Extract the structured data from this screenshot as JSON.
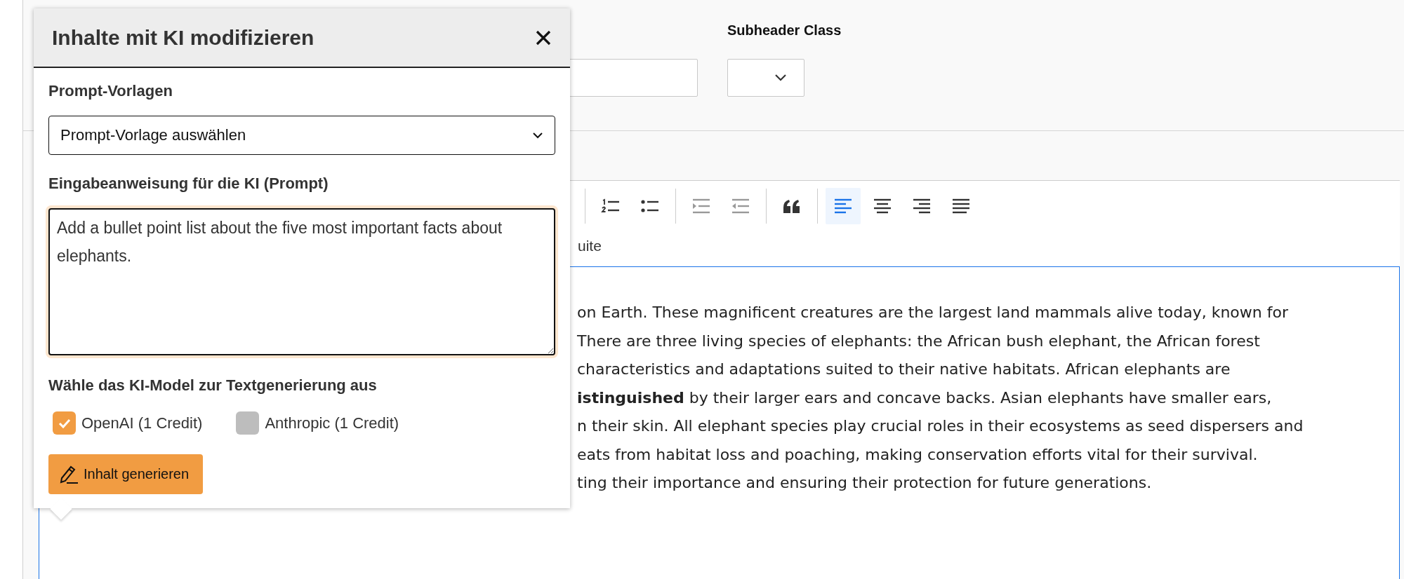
{
  "form": {
    "subheader_label": "Subheader Class"
  },
  "editor": {
    "toolbar_groups": [
      [
        {
          "kind": "ordered-list",
          "selected": false,
          "disabled": false
        },
        {
          "kind": "bullet-list",
          "selected": false,
          "disabled": false
        }
      ],
      [
        {
          "kind": "indent",
          "selected": false,
          "disabled": true
        },
        {
          "kind": "outdent",
          "selected": false,
          "disabled": true
        }
      ],
      [
        {
          "kind": "quote",
          "selected": false,
          "disabled": false
        }
      ],
      [
        {
          "kind": "align-left",
          "selected": true,
          "disabled": false
        },
        {
          "kind": "align-center",
          "selected": false,
          "disabled": false
        },
        {
          "kind": "align-right",
          "selected": false,
          "disabled": false
        },
        {
          "kind": "align-justify",
          "selected": false,
          "disabled": false
        }
      ]
    ],
    "toolbar_text": "uite",
    "lines": [
      "on Earth. These magnificent creatures are the largest land mammals alive today, known for",
      "There are three living species of elephants: the African bush elephant, the African forest",
      "characteristics and adaptations suited to their native habitats. African elephants are",
      "**istinguished** by their larger ears and concave backs. Asian elephants have smaller ears,",
      "n their skin. All elephant species play crucial roles in their ecosystems as seed dispersers and",
      "eats from habitat loss and poaching, making conservation efforts vital for their survival.",
      "ting their importance and ensuring their protection for future generations."
    ]
  },
  "dialog": {
    "title": "Inhalte mit KI modifizieren",
    "template_label": "Prompt-Vorlagen",
    "template_select": {
      "value": "Prompt-Vorlage auswählen"
    },
    "prompt_label": "Eingabeanweisung für die KI (Prompt)",
    "prompt": {
      "value": "Add a bullet point list about the five most important facts about elephants."
    },
    "model_label": "Wähle das KI-Model zur Textgenerierung aus",
    "models": [
      {
        "label": "OpenAI (1 Credit)",
        "checked": true
      },
      {
        "label": "Anthropic (1 Credit)",
        "checked": false
      }
    ],
    "generate_button": "Inhalt generieren"
  }
}
